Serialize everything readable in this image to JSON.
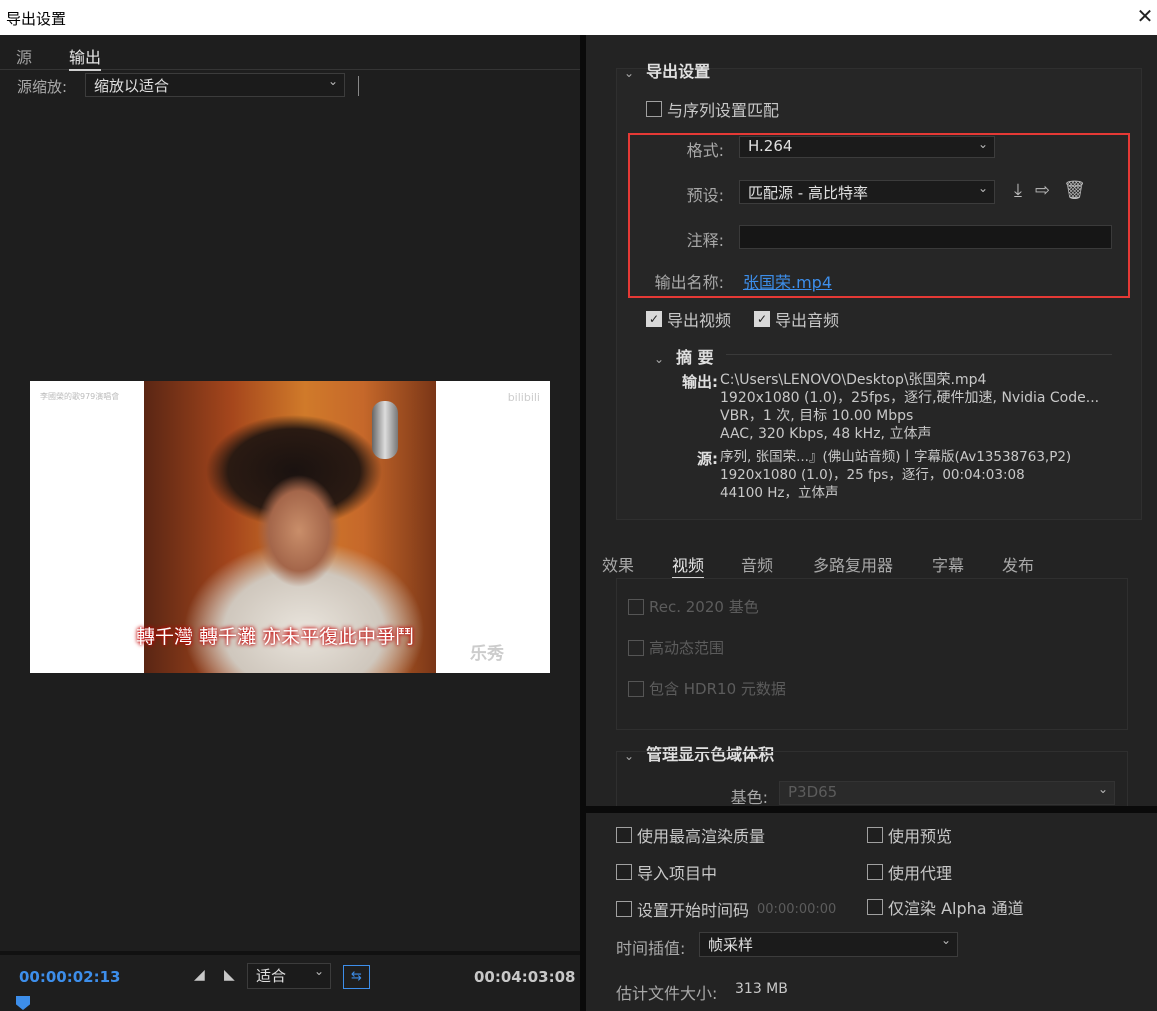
{
  "window": {
    "title": "导出设置",
    "close": "✕"
  },
  "left": {
    "tabs": [
      "源",
      "输出"
    ],
    "scale_label": "源缩放:",
    "scale_value": "缩放以适合",
    "preview": {
      "subtitle": "轉千灣 轉千灘 亦未平復此中爭鬥",
      "watermark_tl": "李國榮的歌979演唱會",
      "watermark_tr": "bilibili",
      "watermark_br": "乐秀"
    },
    "timeline": {
      "current": "00:00:02:13",
      "total": "00:04:03:08",
      "fit": "适合"
    }
  },
  "right": {
    "export_settings": {
      "title": "导出设置",
      "match_sequence": "与序列设置匹配",
      "format_label": "格式:",
      "format_value": "H.264",
      "preset_label": "预设:",
      "preset_value": "匹配源 - 高比特率",
      "comment_label": "注释:",
      "comment_value": "",
      "output_name_label": "输出名称:",
      "output_name_value": "张国荣.mp4",
      "export_video": "导出视频",
      "export_audio": "导出音频"
    },
    "summary": {
      "title": "摘 要",
      "output_key": "输出:",
      "output_lines": [
        "C:\\Users\\LENOVO\\Desktop\\张国荣.mp4",
        "1920x1080 (1.0)，25fps，逐行,硬件加速, Nvidia Code...",
        "VBR，1 次, 目标 10.00 Mbps",
        "AAC, 320 Kbps, 48  kHz, 立体声"
      ],
      "source_key": "源:",
      "source_lines": [
        "序列, 张国荣...』(佛山站音频)丨字幕版(Av13538763,P2)",
        "1920x1080 (1.0)，25 fps，逐行，00:04:03:08",
        "44100 Hz，立体声"
      ]
    },
    "tabs": [
      "效果",
      "视频",
      "音频",
      "多路复用器",
      "字幕",
      "发布"
    ],
    "video": {
      "rec2020": "Rec. 2020 基色",
      "hdr": "高动态范围",
      "hdr10": "包含 HDR10 元数据"
    },
    "gamut": {
      "title": "管理显示色域体积",
      "primary_label": "基色:",
      "primary_value": "P3D65"
    },
    "bottom": {
      "max_quality": "使用最高渲染质量",
      "use_preview": "使用预览",
      "import_project": "导入项目中",
      "use_proxy": "使用代理",
      "set_start_tc": "设置开始时间码",
      "start_tc_value": "00:00:00:00",
      "alpha_only": "仅渲染 Alpha 通道",
      "interp_label": "时间插值:",
      "interp_value": "帧采样",
      "filesize_label": "估计文件大小:",
      "filesize_value": "313 MB"
    }
  }
}
